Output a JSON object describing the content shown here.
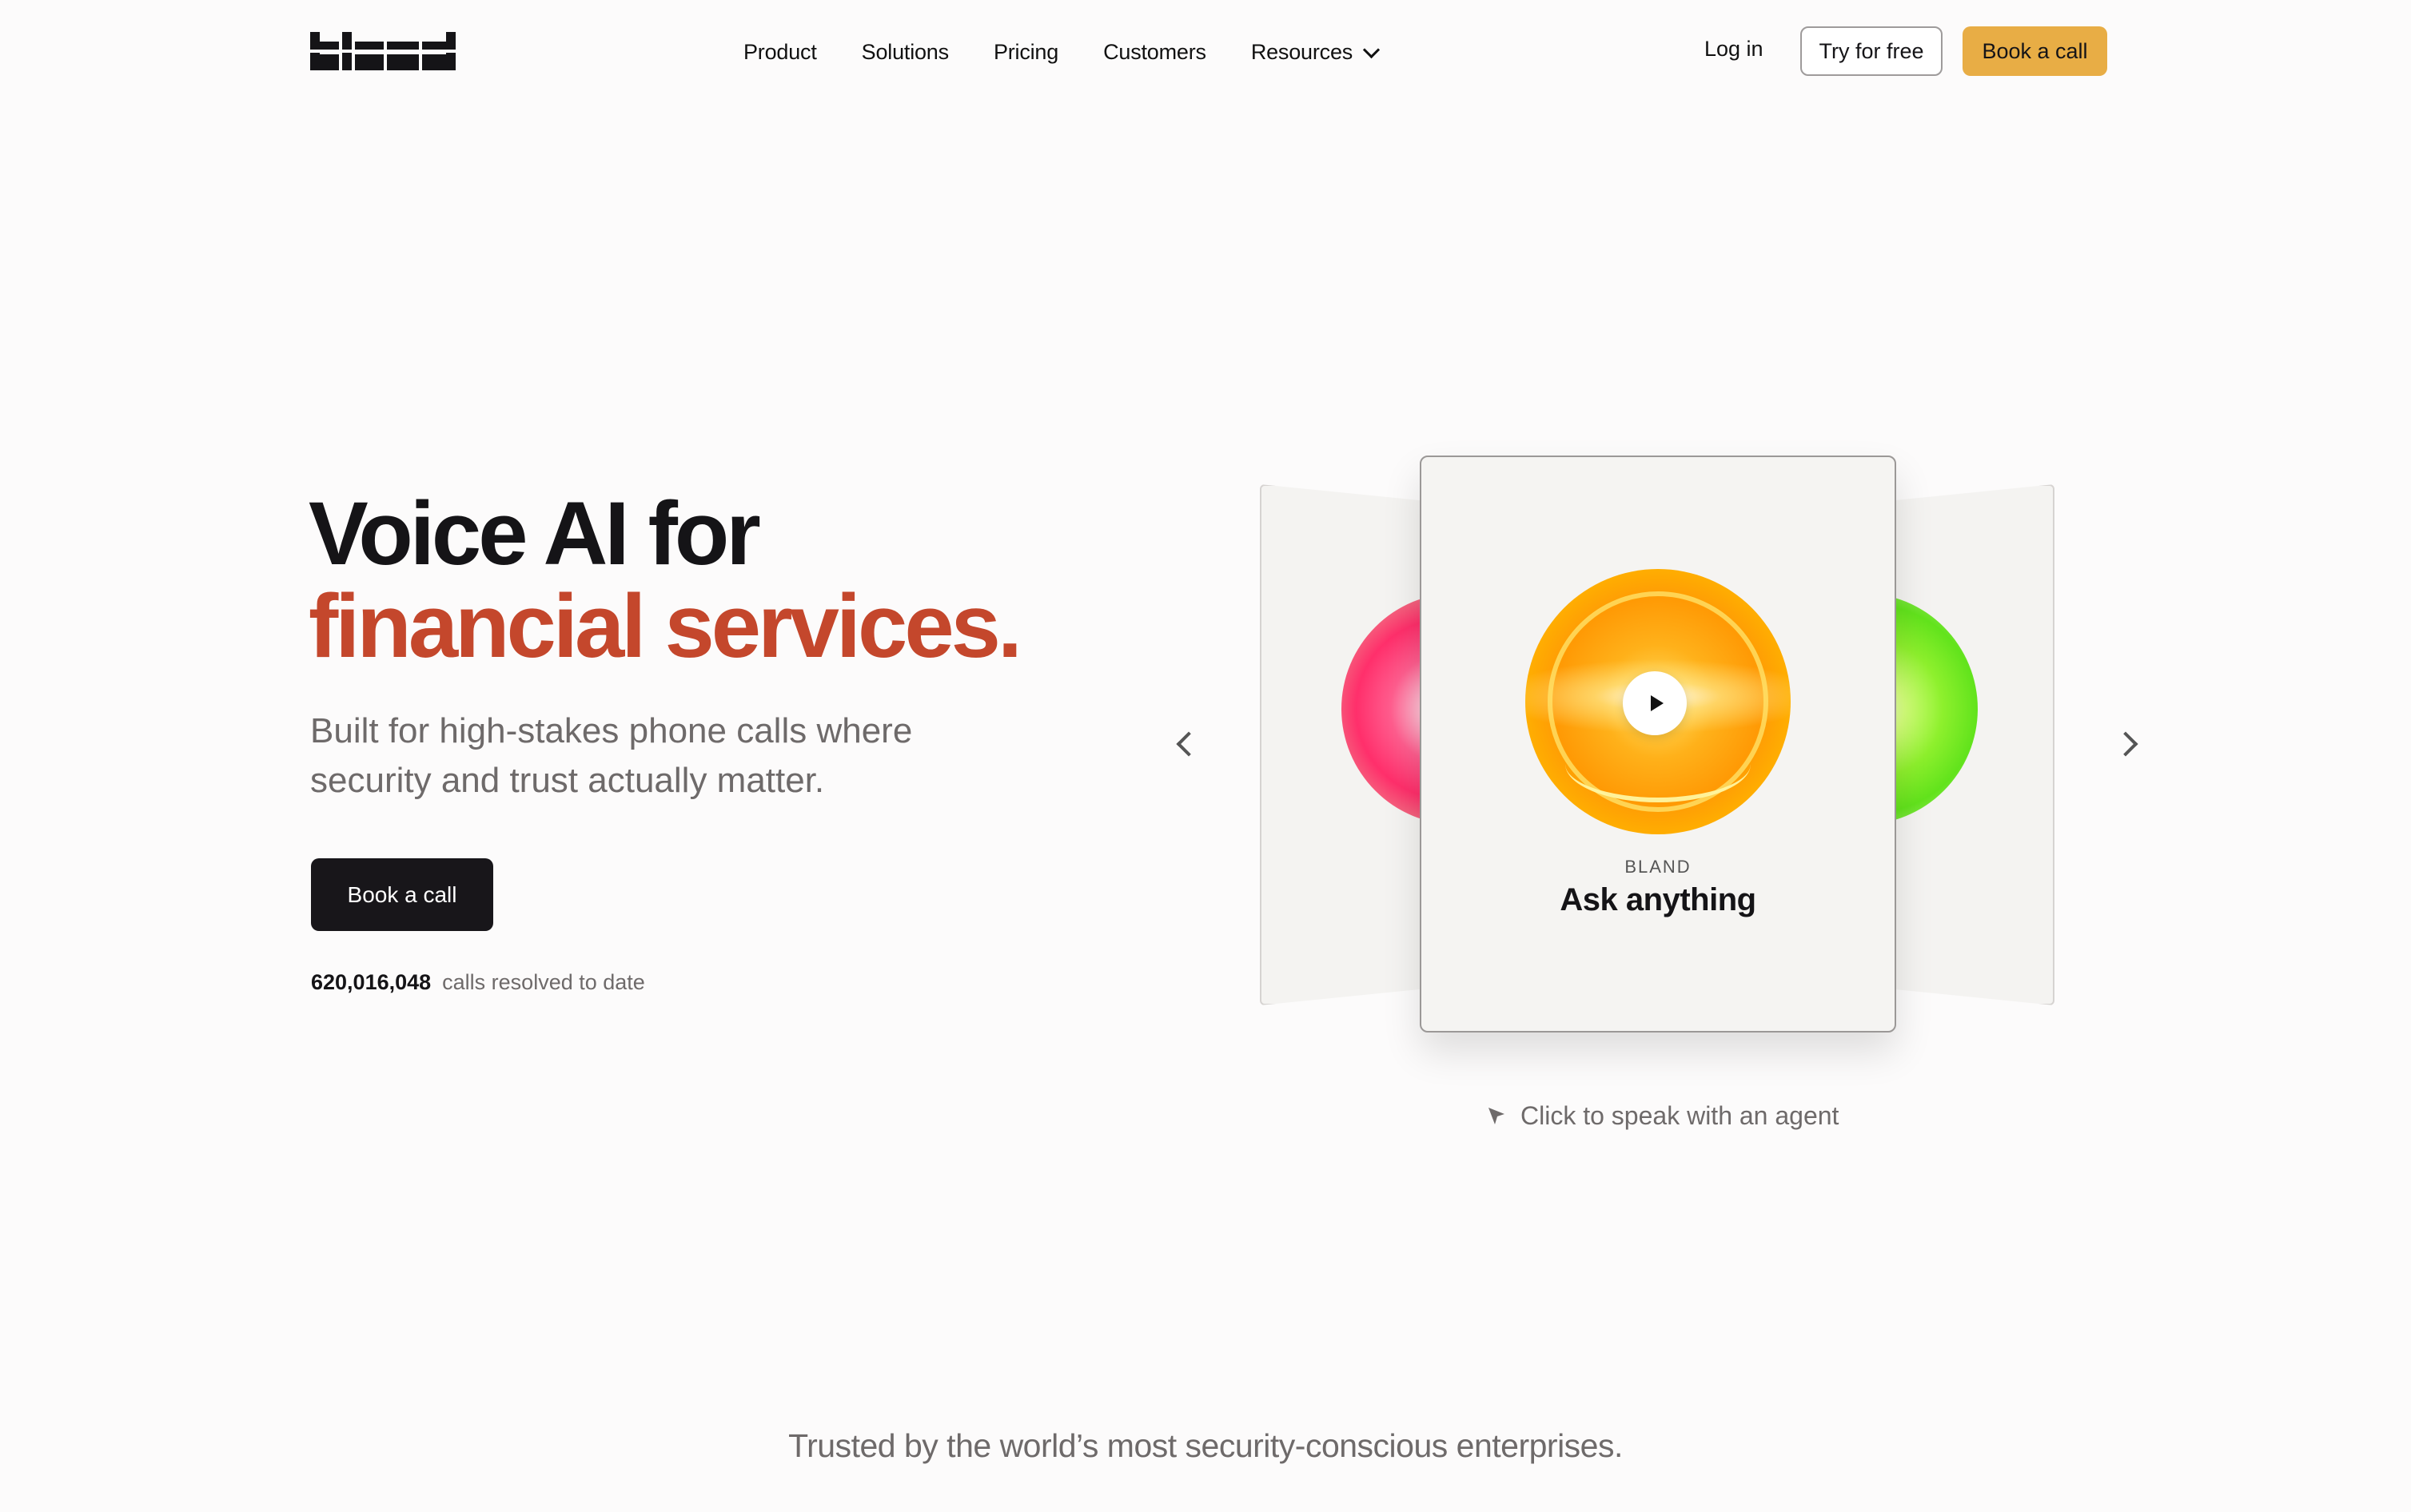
{
  "nav": {
    "logo_text": "bland",
    "links": [
      "Product",
      "Solutions",
      "Pricing",
      "Customers",
      "Resources"
    ],
    "login": "Log in",
    "try_free": "Try for free",
    "book_call": "Book a call"
  },
  "hero": {
    "title_line1": "Voice AI for",
    "title_line2": "financial services.",
    "subtitle": "Built for high-stakes phone calls where security and trust actually matter.",
    "cta": "Book a call",
    "stat_number": "620,016,048",
    "stat_label": "calls resolved to date",
    "accent_color": "#c4472c"
  },
  "carousel": {
    "card_brand": "BLAND",
    "card_title": "Ask anything",
    "hint": "Click to speak with an agent"
  },
  "trusted": {
    "text": "Trusted by the world’s most security-conscious enterprises."
  }
}
